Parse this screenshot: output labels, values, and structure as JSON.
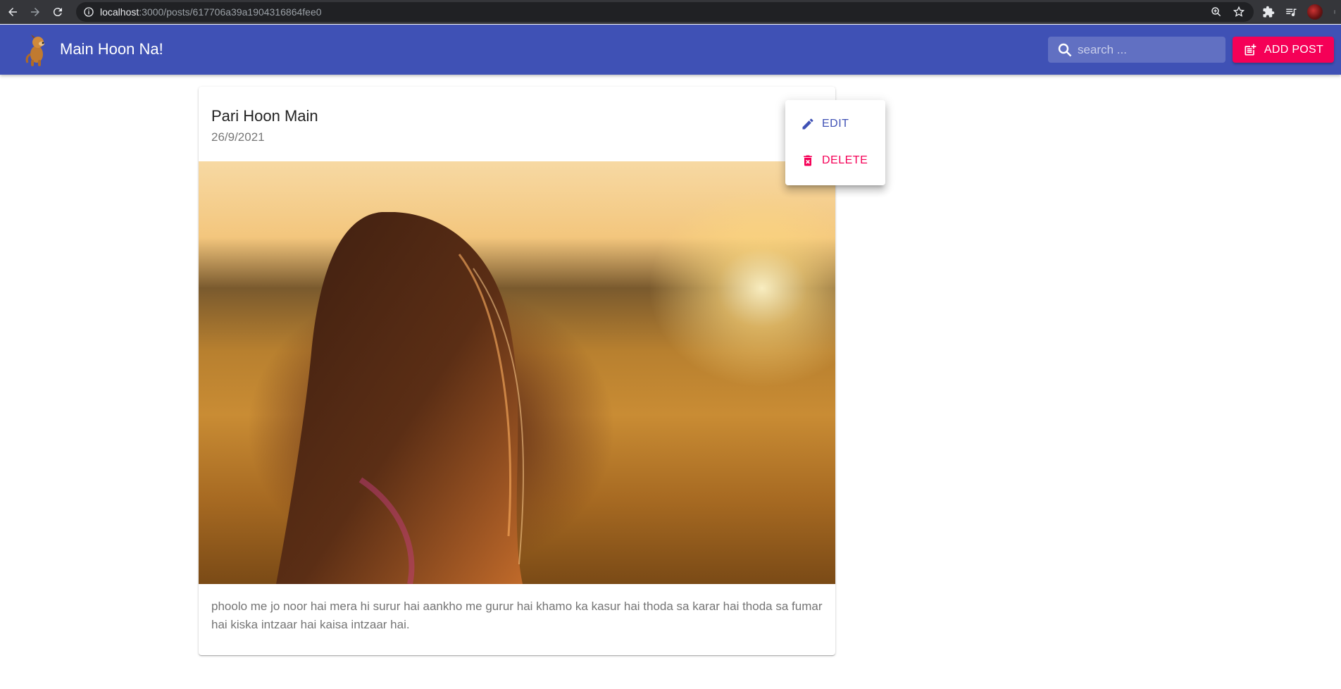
{
  "browser": {
    "url_host": "localhost",
    "url_path": ":3000/posts/617706a39a1904316864fee0"
  },
  "app": {
    "title": "Main Hoon Na!",
    "search_placeholder": "search ...",
    "add_post_label": "ADD POST",
    "primary_color": "#3f51b5",
    "accent_color": "#f50057"
  },
  "post": {
    "title": "Pari Hoon Main",
    "date": "26/9/2021",
    "body": "phoolo me jo noor hai mera hi surur hai aankho me gurur hai khamo ka kasur hai thoda sa karar hai thoda sa fumar hai kiska intzaar hai kaisa intzaar hai."
  },
  "menu": {
    "edit_label": "EDIT",
    "delete_label": "DELETE"
  }
}
